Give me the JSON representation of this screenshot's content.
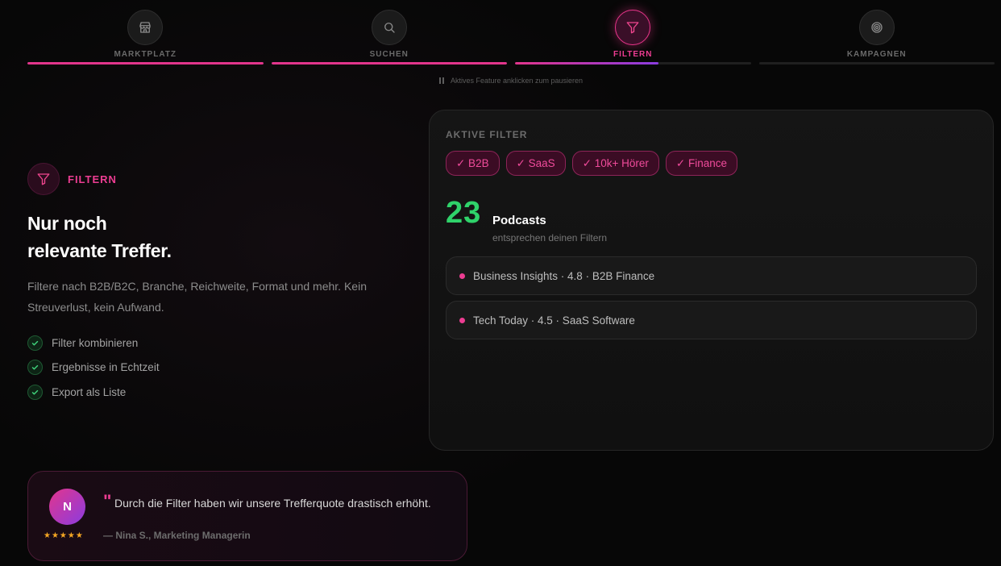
{
  "tabs": [
    {
      "label": "MARKTPLATZ",
      "icon": "store-icon",
      "progress": 1.0,
      "active": false
    },
    {
      "label": "SUCHEN",
      "icon": "search-icon",
      "progress": 1.0,
      "active": false
    },
    {
      "label": "FILTERN",
      "icon": "filter-icon",
      "progress": 0.61,
      "active": true
    },
    {
      "label": "KAMPAGNEN",
      "icon": "target-icon",
      "progress": 0.0,
      "active": false
    }
  ],
  "hint": "Aktives Feature anklicken zum pausieren",
  "feature": {
    "name": "FILTERN",
    "headline_line1": "Nur noch",
    "headline_line2": "relevante Treffer.",
    "description": "Filtere nach B2B/B2C, Branche, Reichweite, Format und mehr. Kein Streuverlust, kein Aufwand.",
    "checks": [
      "Filter kombinieren",
      "Ergebnisse in Echtzeit",
      "Export als Liste"
    ]
  },
  "panel": {
    "title": "AKTIVE FILTER",
    "chips": [
      "✓ B2B",
      "✓ SaaS",
      "✓ 10k+ Hörer",
      "✓ Finance"
    ],
    "count": "23",
    "count_label": "Podcasts",
    "count_sub": "entsprechen deinen Filtern",
    "results": [
      "Business Insights · 4.8 · B2B Finance",
      "Tech Today · 4.5 · SaaS Software"
    ]
  },
  "testimonial": {
    "avatar": "N",
    "stars": "★★★★★",
    "quote_mark": "\"",
    "quote": "Durch die Filter haben wir unsere Trefferquote drastisch erhöht.",
    "author": "— Nina S., Marketing Managerin"
  },
  "colors": {
    "accent": "#e2358c",
    "success": "#2fd26a",
    "star": "#f4a623"
  }
}
